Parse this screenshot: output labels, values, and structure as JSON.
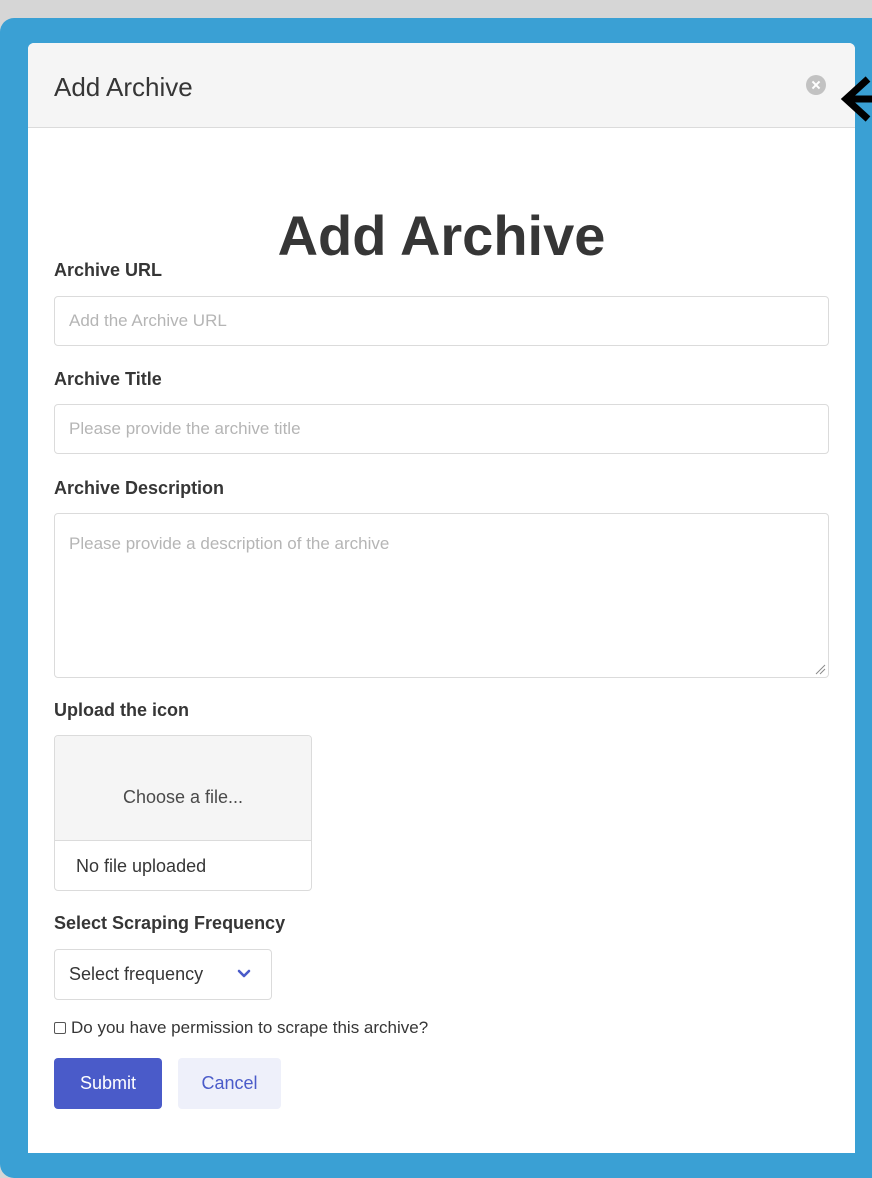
{
  "modal": {
    "header_title": "Add Archive",
    "heading": "Add Archive"
  },
  "form": {
    "url": {
      "label": "Archive URL",
      "placeholder": "Add the Archive URL"
    },
    "title": {
      "label": "Archive Title",
      "placeholder": "Please provide the archive title"
    },
    "description": {
      "label": "Archive Description",
      "placeholder": "Please provide a description of the archive"
    },
    "icon": {
      "label": "Upload the icon",
      "choose_label": "Choose a file...",
      "file_status": "No file uploaded"
    },
    "frequency": {
      "label": "Select Scraping Frequency",
      "selected": "Select frequency"
    },
    "permission": {
      "label": "Do you have permission to scrape this archive?",
      "checked": false
    }
  },
  "actions": {
    "submit_label": "Submit",
    "cancel_label": "Cancel"
  },
  "icons": {
    "close": "close-icon",
    "arrow": "arrow-left-icon",
    "chevron": "chevron-down-icon"
  },
  "colors": {
    "frame": "#3aa0d4",
    "primary": "#4a5bc9",
    "secondary_bg": "#eef0fa"
  }
}
